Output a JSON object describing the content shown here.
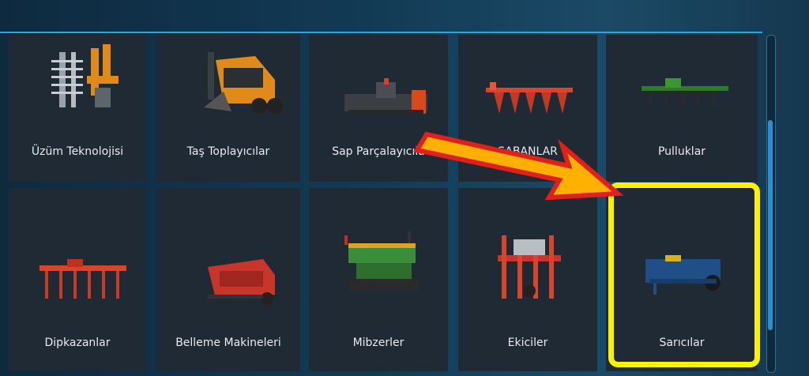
{
  "categories": [
    {
      "label": "Üzüm Teknolojisi",
      "icon": "grape-harvester-icon"
    },
    {
      "label": "Taş Toplayıcılar",
      "icon": "stone-picker-icon"
    },
    {
      "label": "Sap Parçalayıcıla",
      "icon": "mulcher-icon"
    },
    {
      "label": "SABANLAR",
      "icon": "plow-icon"
    },
    {
      "label": "Pulluklar",
      "icon": "cultivator-icon"
    },
    {
      "label": "Dipkazanlar",
      "icon": "subsoiler-icon"
    },
    {
      "label": "Belleme Makineleri",
      "icon": "spader-icon"
    },
    {
      "label": "Mibzerler",
      "icon": "seed-drill-icon"
    },
    {
      "label": "Ekiciler",
      "icon": "planter-icon"
    },
    {
      "label": "Sarıcılar",
      "icon": "roller-icon"
    }
  ],
  "colors": {
    "accent": "#2aa7e0",
    "highlight": "#fff200",
    "arrow_fill": "#ffb000",
    "arrow_stroke": "#e0201a"
  }
}
